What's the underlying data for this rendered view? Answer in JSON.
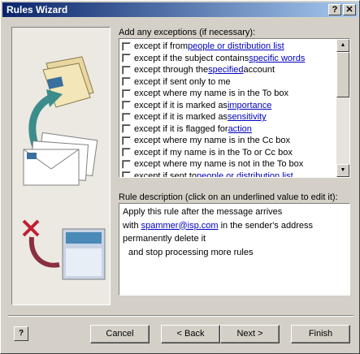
{
  "window": {
    "title": "Rules Wizard",
    "help_glyph": "?",
    "close_glyph": "✕"
  },
  "exceptions": {
    "heading": "Add any exceptions (if necessary):",
    "items": [
      {
        "pre": "except if from ",
        "link": "people or distribution list",
        "post": ""
      },
      {
        "pre": "except if the subject contains ",
        "link": "specific words",
        "post": ""
      },
      {
        "pre": "except through the ",
        "link": "specified",
        "post": " account"
      },
      {
        "pre": "except if sent only to me",
        "link": "",
        "post": ""
      },
      {
        "pre": "except where my name is in the To box",
        "link": "",
        "post": ""
      },
      {
        "pre": "except if it is marked as ",
        "link": "importance",
        "post": ""
      },
      {
        "pre": "except if it is marked as ",
        "link": "sensitivity",
        "post": ""
      },
      {
        "pre": "except if it is flagged for ",
        "link": "action",
        "post": ""
      },
      {
        "pre": "except where my name is in the Cc box",
        "link": "",
        "post": ""
      },
      {
        "pre": "except if my name is in the To or Cc box",
        "link": "",
        "post": ""
      },
      {
        "pre": "except where my name is not in the To box",
        "link": "",
        "post": ""
      },
      {
        "pre": "except if sent to ",
        "link": "people or distribution list",
        "post": ""
      }
    ]
  },
  "description": {
    "heading": "Rule description (click on an underlined value to edit it):",
    "line1": "Apply this rule after the message arrives",
    "line2_pre": "with ",
    "line2_link": "spammer@isp.com",
    "line2_post": " in the sender's address",
    "line3": "permanently delete it",
    "line4": "and stop processing more rules"
  },
  "buttons": {
    "help": "?",
    "cancel": "Cancel",
    "back": "< Back",
    "next": "Next >",
    "finish": "Finish"
  },
  "scrollbar": {
    "up_glyph": "▲",
    "down_glyph": "▼"
  }
}
